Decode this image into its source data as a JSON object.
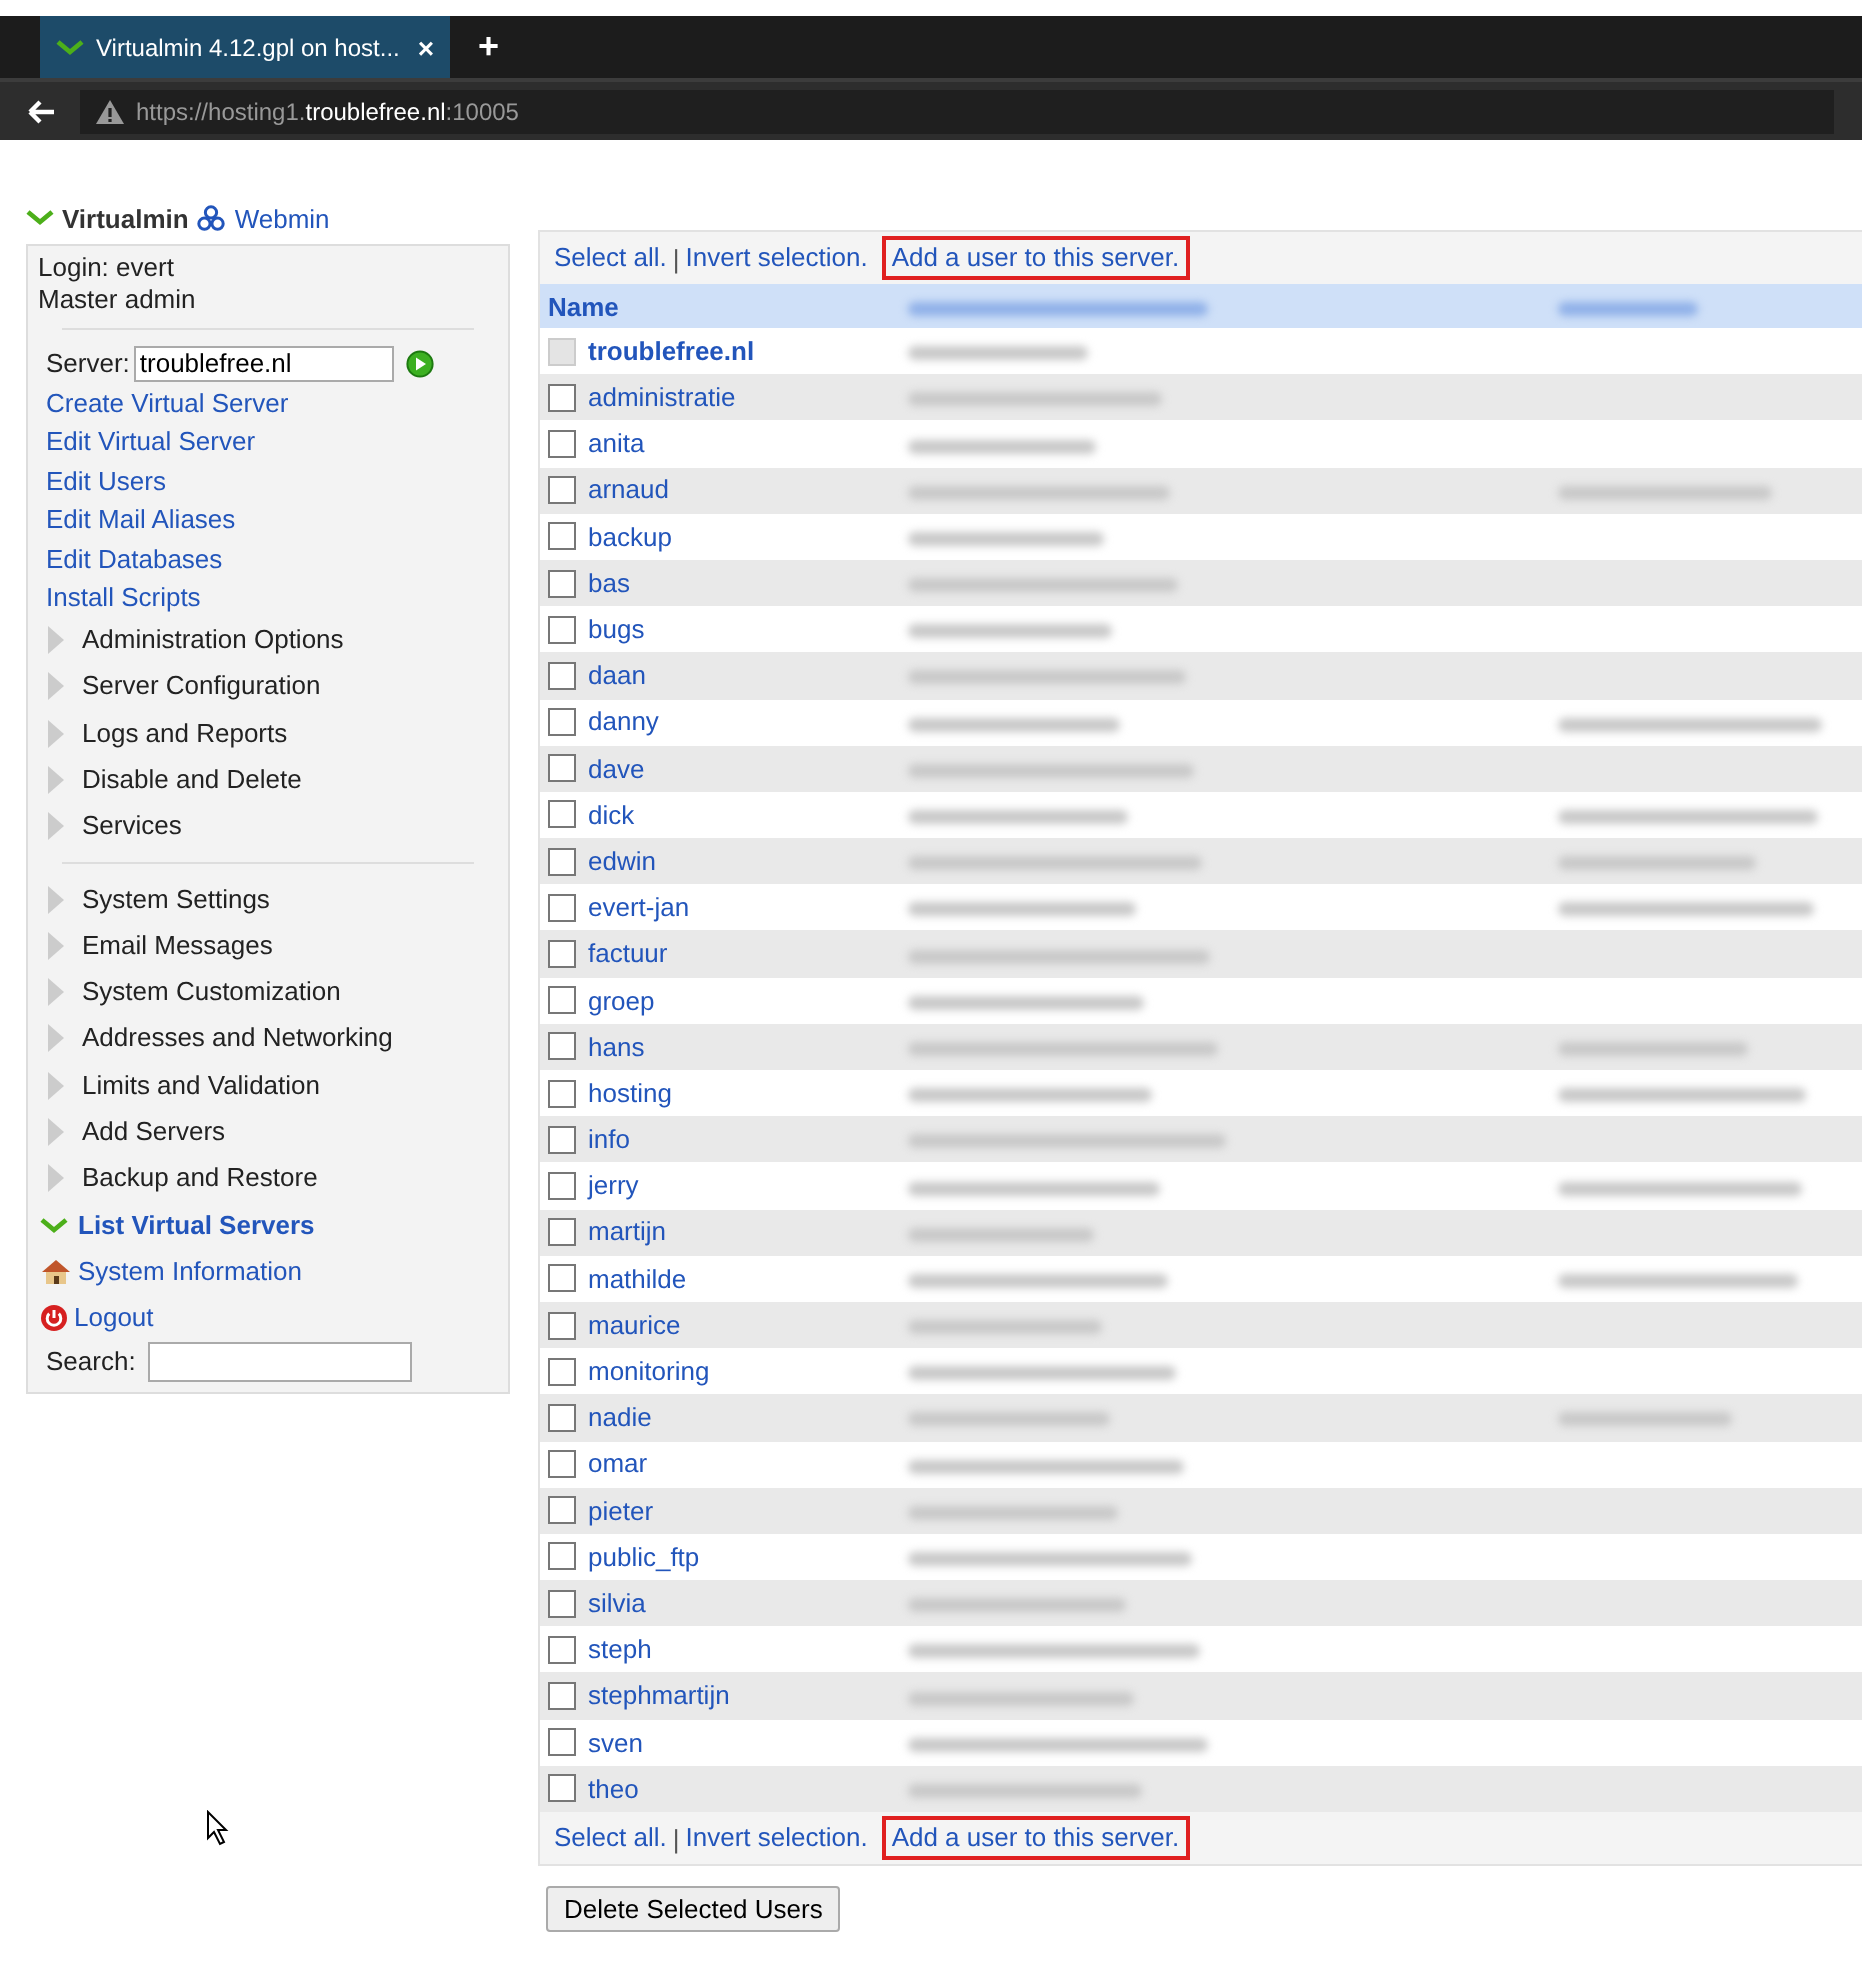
{
  "browser": {
    "tab_title": "Virtualmin 4.12.gpl on host...",
    "tab_close": "×",
    "new_tab": "+",
    "url_prefix": "https://hosting1.",
    "url_domain": "troublefree.nl",
    "url_suffix": ":10005"
  },
  "header": {
    "virtualmin": "Virtualmin",
    "webmin": "Webmin"
  },
  "sidebar": {
    "login": "Login: evert",
    "role": "Master admin",
    "server_label": "Server:",
    "server_value": "troublefree.nl",
    "links": [
      "Create Virtual Server",
      "Edit Virtual Server",
      "Edit Users",
      "Edit Mail Aliases",
      "Edit Databases",
      "Install Scripts"
    ],
    "groups": [
      {
        "label": "Administration Options",
        "expanded": false
      },
      {
        "label": "Server Configuration",
        "expanded": false
      },
      {
        "label": "Logs and Reports",
        "expanded": false
      },
      {
        "label": "Disable and Delete",
        "expanded": false
      },
      {
        "label": "Services",
        "expanded": false
      }
    ],
    "groups2": [
      {
        "label": "System Settings",
        "expanded": false
      },
      {
        "label": "Email Messages",
        "expanded": false
      },
      {
        "label": "System Customization",
        "expanded": false
      },
      {
        "label": "Addresses and Networking",
        "expanded": false
      },
      {
        "label": "Limits and Validation",
        "expanded": false
      },
      {
        "label": "Add Servers",
        "expanded": false
      },
      {
        "label": "Backup and Restore",
        "expanded": false
      },
      {
        "label": "List Virtual Servers",
        "expanded": true
      }
    ],
    "system_information": "System Information",
    "logout": "Logout",
    "search_label": "Search:"
  },
  "table": {
    "actions": [
      {
        "select_all": "Select all.",
        "separator": "|",
        "invert": "Invert selection.",
        "add_user": "Add a user to this server.",
        "add_user_highlighted": true
      },
      {
        "select_all": "Select all.",
        "separator": "|",
        "invert": "Invert selection.",
        "add_user": "Add a user to this server.",
        "add_user_highlighted": true
      }
    ],
    "columns": [
      "Name"
    ],
    "rows": [
      {
        "name": "troublefree.nl",
        "disabled": true,
        "real_name_blurred": false
      },
      {
        "name": "administratie",
        "disabled": false,
        "real_name_blurred": false
      },
      {
        "name": "anita",
        "disabled": false,
        "real_name_blurred": false
      },
      {
        "name": "arnaud",
        "disabled": false,
        "real_name_blurred": true
      },
      {
        "name": "backup",
        "disabled": false,
        "real_name_blurred": false
      },
      {
        "name": "bas",
        "disabled": false,
        "real_name_blurred": false
      },
      {
        "name": "bugs",
        "disabled": false,
        "real_name_blurred": false
      },
      {
        "name": "daan",
        "disabled": false,
        "real_name_blurred": false
      },
      {
        "name": "danny",
        "disabled": false,
        "real_name_blurred": true
      },
      {
        "name": "dave",
        "disabled": false,
        "real_name_blurred": false
      },
      {
        "name": "dick",
        "disabled": false,
        "real_name_blurred": true
      },
      {
        "name": "edwin",
        "disabled": false,
        "real_name_blurred": true
      },
      {
        "name": "evert-jan",
        "disabled": false,
        "real_name_blurred": true
      },
      {
        "name": "factuur",
        "disabled": false,
        "real_name_blurred": false
      },
      {
        "name": "groep",
        "disabled": false,
        "real_name_blurred": false
      },
      {
        "name": "hans",
        "disabled": false,
        "real_name_blurred": true
      },
      {
        "name": "hosting",
        "disabled": false,
        "real_name_blurred": true
      },
      {
        "name": "info",
        "disabled": false,
        "real_name_blurred": false
      },
      {
        "name": "jerry",
        "disabled": false,
        "real_name_blurred": true
      },
      {
        "name": "martijn",
        "disabled": false,
        "real_name_blurred": false
      },
      {
        "name": "mathilde",
        "disabled": false,
        "real_name_blurred": true
      },
      {
        "name": "maurice",
        "disabled": false,
        "real_name_blurred": false
      },
      {
        "name": "monitoring",
        "disabled": false,
        "real_name_blurred": false
      },
      {
        "name": "nadie",
        "disabled": false,
        "real_name_blurred": true
      },
      {
        "name": "omar",
        "disabled": false,
        "real_name_blurred": false
      },
      {
        "name": "pieter",
        "disabled": false,
        "real_name_blurred": false
      },
      {
        "name": "public_ftp",
        "disabled": false,
        "real_name_blurred": false
      },
      {
        "name": "silvia",
        "disabled": false,
        "real_name_blurred": false
      },
      {
        "name": "steph",
        "disabled": false,
        "real_name_blurred": false
      },
      {
        "name": "stephmartijn",
        "disabled": false,
        "real_name_blurred": false
      },
      {
        "name": "sven",
        "disabled": false,
        "real_name_blurred": false
      },
      {
        "name": "theo",
        "disabled": false,
        "real_name_blurred": false
      }
    ],
    "delete_button": "Delete Selected Users"
  }
}
